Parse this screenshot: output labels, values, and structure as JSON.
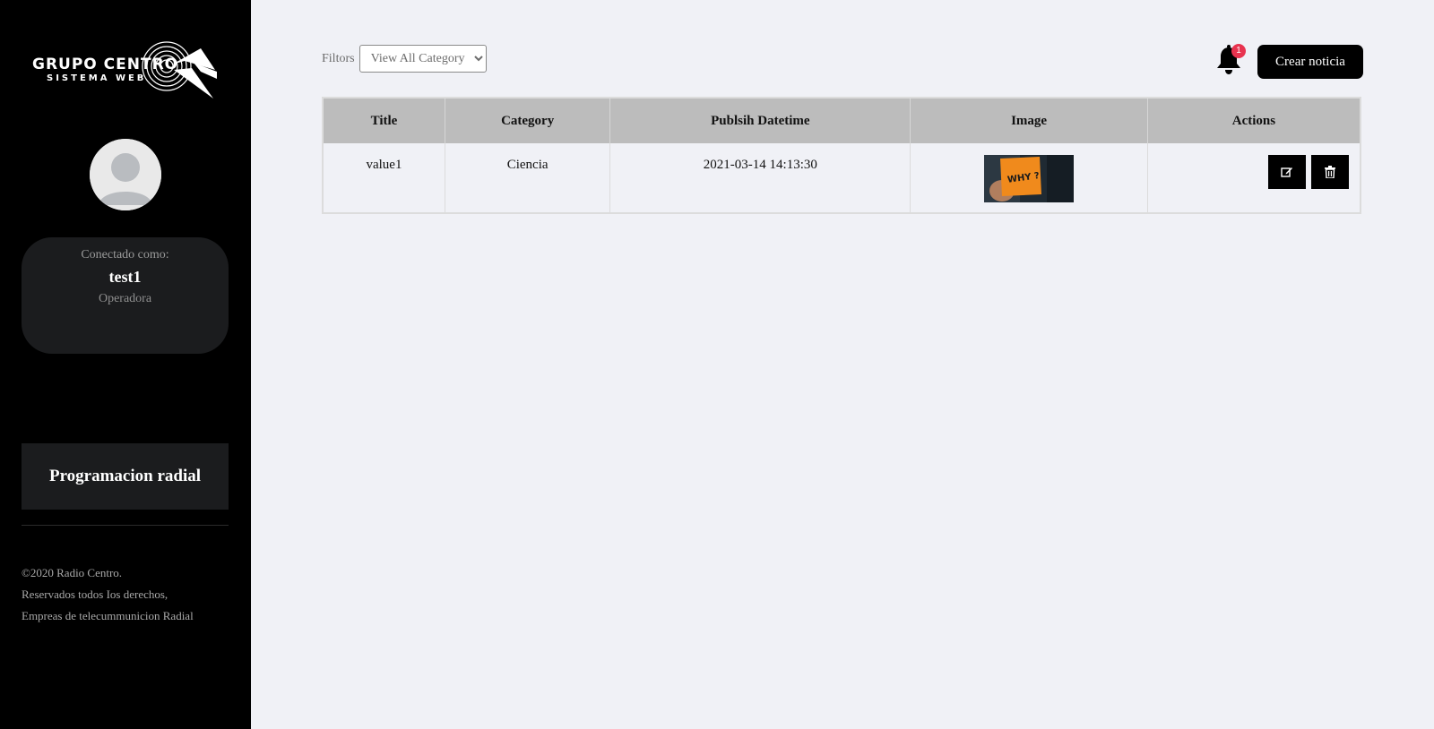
{
  "brand": {
    "name": "GRUPO CENTRO",
    "tagline": "SISTEMA WEB"
  },
  "user": {
    "connected_label": "Conectado como:",
    "username": "test1",
    "role": "Operadora"
  },
  "nav": {
    "items": [
      {
        "label": "Programacion radial"
      }
    ]
  },
  "footer": {
    "line1": "©2020 Radio Centro.",
    "line2": "Reservados todos Ios derechos,",
    "line3": "Empreas de telecummunicion Radial"
  },
  "toolbar": {
    "filters_label": "Filtors",
    "category_select": {
      "selected": "View All Category",
      "options": [
        "View All Category"
      ]
    },
    "notifications_count": "1",
    "create_label": "Crear noticia"
  },
  "table": {
    "headers": [
      "Title",
      "Category",
      "Publsih Datetime",
      "Image",
      "Actions"
    ],
    "rows": [
      {
        "title": "value1",
        "category": "Ciencia",
        "datetime": "2021-03-14 14:13:30",
        "image_text": "WHY ?"
      }
    ]
  },
  "colors": {
    "sidebar_bg": "#000000",
    "card_bg": "#1b1c1e",
    "main_bg": "#f0f1f6",
    "header_bg": "#bcbcbc",
    "badge": "#e8334f",
    "thumb_note": "#f08a1c"
  },
  "icons": {
    "bell": "bell-icon",
    "edit": "edit-icon",
    "delete": "trash-icon",
    "avatar": "user-placeholder-icon"
  }
}
